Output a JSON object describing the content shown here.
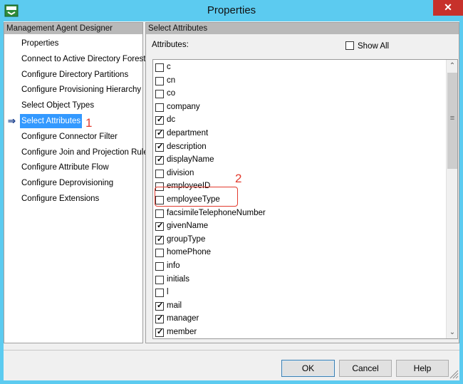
{
  "window": {
    "title": "Properties",
    "close_glyph": "✕",
    "app_icon": "management-agent-icon"
  },
  "left_panel": {
    "header": "Management Agent Designer",
    "items": [
      {
        "label": "Properties"
      },
      {
        "label": "Connect to Active Directory Forest"
      },
      {
        "label": "Configure Directory Partitions"
      },
      {
        "label": "Configure Provisioning Hierarchy"
      },
      {
        "label": "Select Object Types"
      },
      {
        "label": "Select Attributes",
        "selected": true
      },
      {
        "label": "Configure Connector Filter"
      },
      {
        "label": "Configure Join and Projection Rules"
      },
      {
        "label": "Configure Attribute Flow"
      },
      {
        "label": "Configure Deprovisioning"
      },
      {
        "label": "Configure Extensions"
      }
    ],
    "arrow_glyph": "⇒",
    "callout": "1"
  },
  "right_panel": {
    "header": "Select Attributes",
    "attributes_label": "Attributes:",
    "show_all_label": "Show All",
    "show_all_checked": false,
    "callout": "2",
    "attributes": [
      {
        "name": "c",
        "checked": false
      },
      {
        "name": "cn",
        "checked": false
      },
      {
        "name": "co",
        "checked": false
      },
      {
        "name": "company",
        "checked": false
      },
      {
        "name": "dc",
        "checked": true
      },
      {
        "name": "department",
        "checked": true
      },
      {
        "name": "description",
        "checked": true
      },
      {
        "name": "displayName",
        "checked": true
      },
      {
        "name": "division",
        "checked": false
      },
      {
        "name": "employeeID",
        "checked": false
      },
      {
        "name": "employeeType",
        "checked": false
      },
      {
        "name": "facsimileTelephoneNumber",
        "checked": false
      },
      {
        "name": "givenName",
        "checked": true
      },
      {
        "name": "groupType",
        "checked": true
      },
      {
        "name": "homePhone",
        "checked": false
      },
      {
        "name": "info",
        "checked": false
      },
      {
        "name": "initials",
        "checked": false
      },
      {
        "name": "l",
        "checked": false
      },
      {
        "name": "mail",
        "checked": true
      },
      {
        "name": "manager",
        "checked": true
      },
      {
        "name": "member",
        "checked": true
      }
    ],
    "scroll_up_glyph": "⌃",
    "scroll_down_glyph": "⌄",
    "scroll_grip_glyph": "≡"
  },
  "buttons": {
    "ok": "OK",
    "cancel": "Cancel",
    "help": "Help"
  },
  "colors": {
    "titlebar": "#5ccbf0",
    "selection": "#3399ff",
    "callout": "#e23a2d"
  }
}
